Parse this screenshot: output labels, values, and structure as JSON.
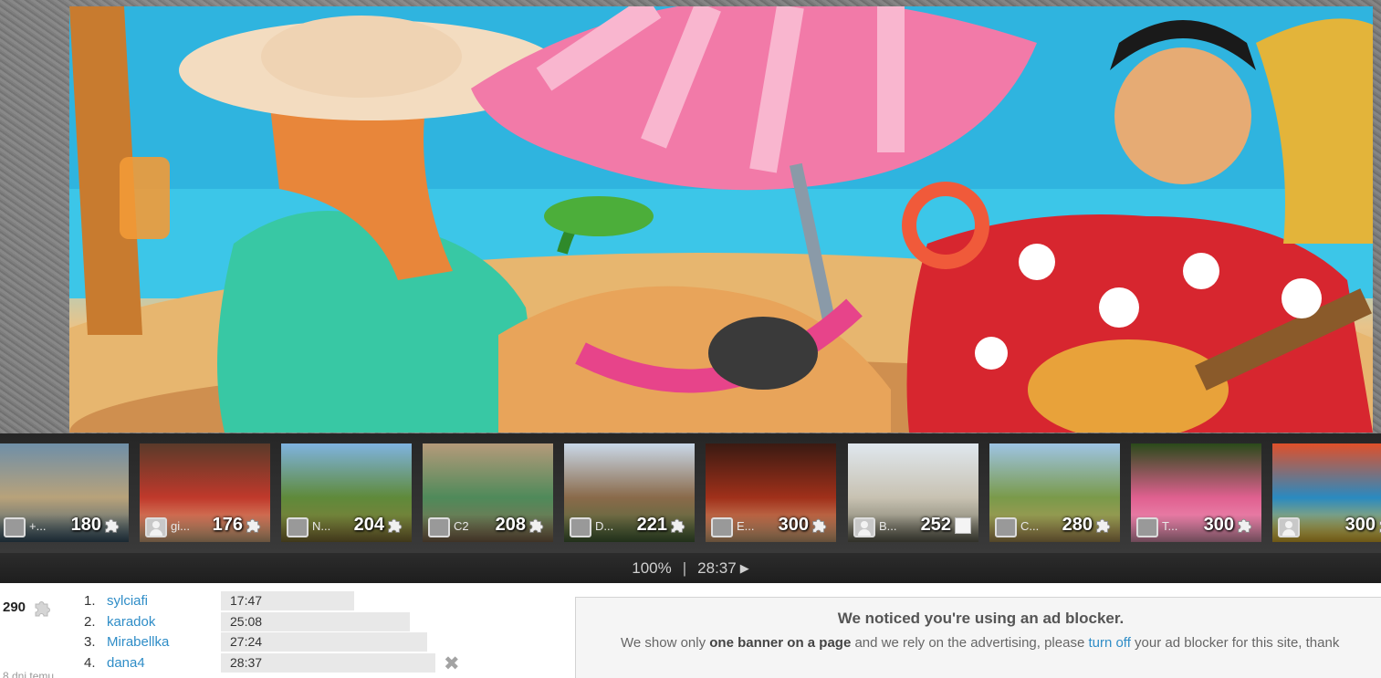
{
  "thumbnails": [
    {
      "user": "+...",
      "count": "180",
      "icon": "puzzle-icon",
      "avatar": "photo",
      "colors": [
        "#6f8fa8",
        "#b8a27a",
        "#3c5a6e"
      ]
    },
    {
      "user": "gi...",
      "count": "176",
      "icon": "puzzle-icon",
      "avatar": "generic",
      "colors": [
        "#5a3a2a",
        "#c0392b",
        "#e6b98a"
      ]
    },
    {
      "user": "N...",
      "count": "204",
      "icon": "puzzle-icon",
      "avatar": "photo",
      "colors": [
        "#7fb3e0",
        "#5f8a3a",
        "#8c7a3a"
      ]
    },
    {
      "user": "C2",
      "count": "208",
      "icon": "puzzle-icon",
      "avatar": "photo",
      "colors": [
        "#b59a7a",
        "#4f8a5a",
        "#8a6e52"
      ]
    },
    {
      "user": "D...",
      "count": "221",
      "icon": "puzzle-icon",
      "avatar": "photo",
      "colors": [
        "#c9d8e8",
        "#8a6a4a",
        "#4a6a3a"
      ]
    },
    {
      "user": "E...",
      "count": "300",
      "icon": "puzzle-icon",
      "avatar": "photo",
      "colors": [
        "#3a1a12",
        "#a0301a",
        "#e0b080"
      ]
    },
    {
      "user": "B...",
      "count": "252",
      "icon": "square-icon",
      "avatar": "generic",
      "colors": [
        "#dfe7ee",
        "#c8c2b2",
        "#6a6a5a"
      ]
    },
    {
      "user": "C...",
      "count": "280",
      "icon": "puzzle-icon",
      "avatar": "photo",
      "colors": [
        "#9ec4e4",
        "#7a9a4a",
        "#b89a5a"
      ]
    },
    {
      "user": "T...",
      "count": "300",
      "icon": "puzzle-icon",
      "avatar": "photo",
      "colors": [
        "#2a4a1a",
        "#e06090",
        "#f2a0c0"
      ]
    },
    {
      "user": "",
      "count": "300",
      "icon": "puzzle-icon",
      "avatar": "generic",
      "colors": [
        "#e0502a",
        "#2a8ac0",
        "#f0c030"
      ]
    }
  ],
  "progress": {
    "percent": "100%",
    "separator": "|",
    "time": "28:37",
    "play_icon": "play-icon"
  },
  "score": {
    "value": "290",
    "ago": "8 dni temu"
  },
  "ranking": [
    {
      "rank": "1.",
      "name": "sylciafi",
      "time": "17:47",
      "bar": 0.62
    },
    {
      "rank": "2.",
      "name": "karadok",
      "time": "25:08",
      "bar": 0.88
    },
    {
      "rank": "3.",
      "name": "Mirabellka",
      "time": "27:24",
      "bar": 0.96
    },
    {
      "rank": "4.",
      "name": "dana4",
      "time": "28:37",
      "bar": 1.0,
      "removable": true
    }
  ],
  "ad_notice": {
    "title": "We noticed you're using an ad blocker.",
    "msg_part1": "We show only ",
    "msg_bold": "one banner on a page",
    "msg_part2": " and we rely on the advertising, please ",
    "msg_link": "turn off",
    "msg_part3": " your ad blocker for this site, thank"
  }
}
